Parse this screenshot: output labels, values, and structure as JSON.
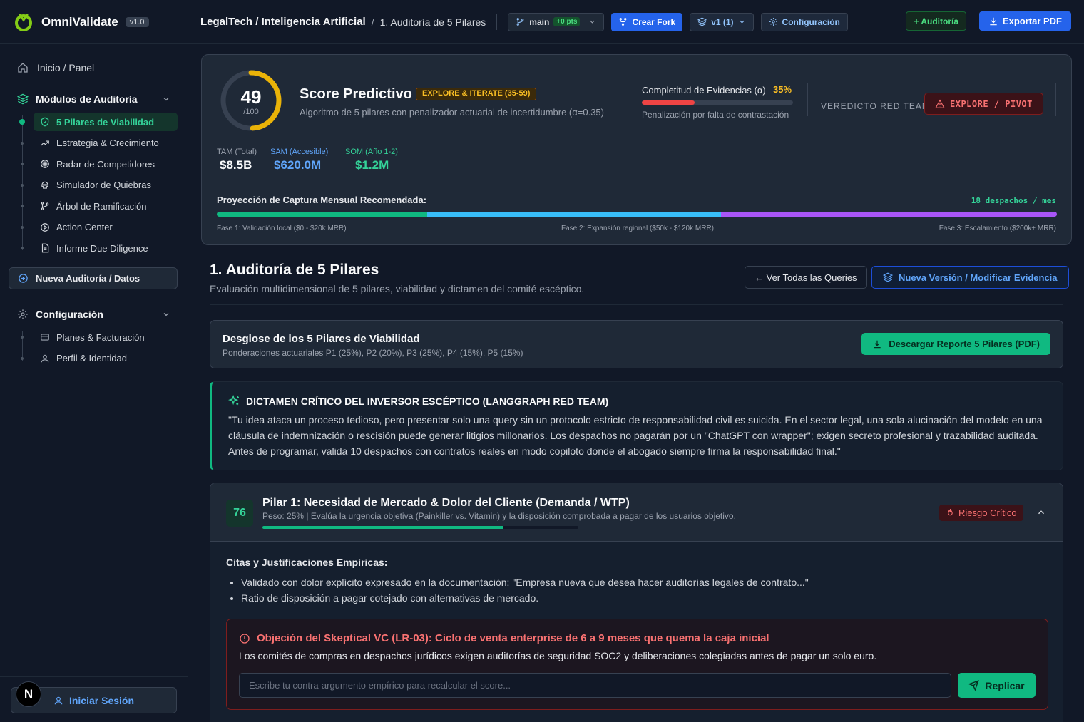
{
  "brand": {
    "name": "OmniValidate",
    "version": "v1.0"
  },
  "sidebar": {
    "home": "Inicio / Panel",
    "modules_title": "Módulos de Auditoría",
    "modules": [
      {
        "label": "5 Pilares de Viabilidad",
        "icon": "shield-check-icon",
        "active": true
      },
      {
        "label": "Estrategia & Crecimiento",
        "icon": "trending-up-icon"
      },
      {
        "label": "Radar de Competidores",
        "icon": "radar-icon"
      },
      {
        "label": "Simulador de Quiebras",
        "icon": "skull-icon"
      },
      {
        "label": "Árbol de Ramificación",
        "icon": "git-branch-icon"
      },
      {
        "label": "Action Center",
        "icon": "play-circle-icon"
      },
      {
        "label": "Informe Due Diligence",
        "icon": "file-text-icon"
      }
    ],
    "new_audit": "Nueva Auditoría / Datos",
    "config_title": "Configuración",
    "config_items": [
      {
        "label": "Planes & Facturación",
        "icon": "credit-card-icon"
      },
      {
        "label": "Perfil & Identidad",
        "icon": "user-icon"
      }
    ],
    "login": "Iniciar Sesión",
    "avatar_letter": "N"
  },
  "topbar": {
    "breadcrumb_project": "LegalTech / Inteligencia Artificial",
    "breadcrumb_sep": "/",
    "breadcrumb_page": "1. Auditoría de 5 Pilares",
    "branch": "main",
    "branch_pts": "+0 pts",
    "fork": "Crear Fork",
    "version": "v1 (1)",
    "config": "Configuración",
    "audit": "+ Auditoría",
    "export": "Exportar PDF"
  },
  "score": {
    "value": "49",
    "max": "/100",
    "value_fraction": 0.49,
    "title": "Score Predictivo",
    "badge": "EXPLORE & ITERATE (35-59)",
    "description": "Algoritmo de 5 pilares con penalizador actuarial de incertidumbre (α=0.35)",
    "evidence_label": "Completitud de Evidencias (α)",
    "evidence_pct": "35%",
    "evidence_fraction": 0.35,
    "evidence_note": "Penalización por falta de contrastación",
    "verdict_label": "VEREDICTO RED TEAM",
    "verdict": "EXPLORE / PIVOT",
    "tam_label": "TAM (Total)",
    "tam": "$8.5B",
    "sam_label": "SAM (Accesible)",
    "sam": "$620.0M",
    "som_label": "SOM (Año 1-2)",
    "som": "$1.2M",
    "projection_label": "Proyección de Captura Mensual Recomendada:",
    "projection_value": "18 despachos / mes",
    "phases": [
      {
        "label": "Fase 1: Validación local ($0 - $20k MRR)",
        "color": "#10b981",
        "share": 0.25
      },
      {
        "label": "Fase 2: Expansión regional ($50k - $120k MRR)",
        "color": "#38bdf8",
        "share": 0.35
      },
      {
        "label": "Fase 3: Escalamiento ($200k+ MRR)",
        "color": "#a855f7",
        "share": 0.4
      }
    ]
  },
  "section": {
    "title": "1. Auditoría de 5 Pilares",
    "subtitle": "Evaluación multidimensional de 5 pilares, viabilidad y dictamen del comité escéptico.",
    "queries_btn": "← Ver Todas las Queries",
    "new_version_btn": "Nueva Versión / Modificar Evidencia"
  },
  "pillars_header": {
    "title": "Desglose de los 5 Pilares de Viabilidad",
    "subtitle": "Ponderaciones actuariales P1 (25%), P2 (20%), P3 (25%), P4 (15%), P5 (15%)",
    "download": "Descargar Reporte 5 Pilares (PDF)"
  },
  "dictamen": {
    "title": "DICTAMEN CRÍTICO DEL INVERSOR ESCÉPTICO (LANGGRAPH RED TEAM)",
    "text": "\"Tu idea ataca un proceso tedioso, pero presentar solo una query sin un protocolo estricto de responsabilidad civil es suicida. En el sector legal, una sola alucinación del modelo en una cláusula de indemnización o rescisión puede generar litigios millonarios. Los despachos no pagarán por un \"ChatGPT con wrapper\"; exigen secreto profesional y trazabilidad auditada. Antes de programar, valida 10 despachos con contratos reales en modo copiloto donde el abogado siempre firma la responsabilidad final.\""
  },
  "pillar1": {
    "score": "76",
    "score_fraction": 0.76,
    "title": "Pilar 1: Necesidad de Mercado & Dolor del Cliente (Demanda / WTP)",
    "subtitle": "Peso: 25% | Evalúa la urgencia objetiva (Painkiller vs. Vitamin) y la disposición comprobada a pagar de los usuarios objetivo.",
    "risk": "Riesgo Crítico",
    "cites_title": "Citas y Justificaciones Empíricas:",
    "cites": [
      "Validado con dolor explícito expresado en la documentación: \"Empresa nueva que desea hacer auditorías legales de contrato...\"",
      "Ratio de disposición a pagar cotejado con alternativas de mercado."
    ],
    "objection_title": "Objeción del Skeptical VC (LR-03): Ciclo de venta enterprise de 6 a 9 meses que quema la caja inicial",
    "objection_text": "Los comités de compras en despachos jurídicos exigen auditorías de seguridad SOC2 y deliberaciones colegiadas antes de pagar un solo euro.",
    "input_placeholder": "Escribe tu contra-argumento empírico para recalcular el score...",
    "reply": "Replicar"
  }
}
